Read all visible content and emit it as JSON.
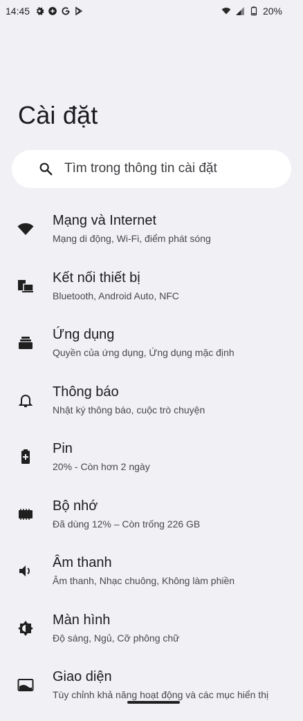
{
  "status_bar": {
    "time": "14:45",
    "battery_text": "20%",
    "left_icons": [
      "gear-icon",
      "game-icon",
      "google-icon",
      "play-store-icon"
    ],
    "right_icons": [
      "wifi-icon",
      "signal-icon",
      "battery-icon"
    ]
  },
  "page": {
    "title": "Cài đặt"
  },
  "search": {
    "placeholder": "Tìm trong thông tin cài đặt",
    "icon": "search-icon"
  },
  "items": [
    {
      "icon": "wifi-icon",
      "title": "Mạng và Internet",
      "subtitle": "Mạng di động, Wi-Fi, điểm phát sóng"
    },
    {
      "icon": "devices-icon",
      "title": "Kết nối thiết bị",
      "subtitle": "Bluetooth, Android Auto, NFC"
    },
    {
      "icon": "apps-icon",
      "title": "Ứng dụng",
      "subtitle": "Quyền của ứng dụng, Ứng dụng mặc định"
    },
    {
      "icon": "bell-icon",
      "title": "Thông báo",
      "subtitle": "Nhật ký thông báo, cuộc trò chuyện"
    },
    {
      "icon": "battery-icon",
      "title": "Pin",
      "subtitle": "20% - Còn hơn 2 ngày"
    },
    {
      "icon": "storage-icon",
      "title": "Bộ nhớ",
      "subtitle": "Đã dùng 12% – Còn trống 226 GB"
    },
    {
      "icon": "volume-icon",
      "title": "Âm thanh",
      "subtitle": "Âm thanh, Nhạc chuông, Không làm phiền"
    },
    {
      "icon": "brightness-icon",
      "title": "Màn hình",
      "subtitle": "Độ sáng, Ngủ, Cỡ phông chữ"
    },
    {
      "icon": "wallpaper-icon",
      "title": "Giao diện",
      "subtitle": "Tùy chỉnh khả năng hoạt động và các mục hiển thị"
    }
  ]
}
